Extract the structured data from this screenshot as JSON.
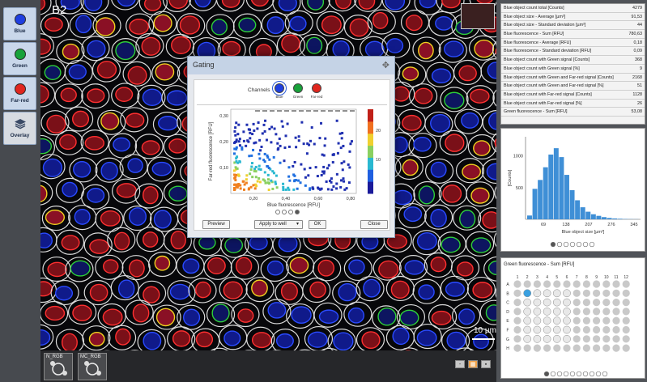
{
  "channels": [
    {
      "label": "Blue",
      "color": "#1f3fe0"
    },
    {
      "label": "Green",
      "color": "#18a23a"
    },
    {
      "label": "Far-red",
      "color": "#e0261e"
    }
  ],
  "overlay_label": "Overlay",
  "viewer": {
    "well": "B2",
    "scale": "10 µm"
  },
  "bottom": {
    "image_buttons": [
      "N_RGB",
      "MC_RGB"
    ],
    "view_buttons": [
      "-",
      "▦",
      "▪"
    ]
  },
  "stats": [
    {
      "label": "Blue object count total [Counts]",
      "value": "4279"
    },
    {
      "label": "Blue object size - Average [µm²]",
      "value": "91,53"
    },
    {
      "label": "Blue object size - Standard deviation [µm²]",
      "value": "44"
    },
    {
      "label": "Blue fluorescence - Sum [RFU]",
      "value": "780,63"
    },
    {
      "label": "Blue fluorescence - Average [RFU]",
      "value": "0,18"
    },
    {
      "label": "Blue fluorescence - Standard deviation [RFU]",
      "value": "0,09"
    },
    {
      "label": "Blue object count with Green signal [Counts]",
      "value": "368"
    },
    {
      "label": "Blue object count  with Green signal [%]",
      "value": "9"
    },
    {
      "label": "Blue object count with Green and Far-red signal [Counts]",
      "value": "2168"
    },
    {
      "label": "Blue object count  with Green and Far-red signal [%]",
      "value": "51"
    },
    {
      "label": "Blue object count with Far-red signal [Counts]",
      "value": "1128"
    },
    {
      "label": "Blue object count  with Far-red signal [%]",
      "value": "26"
    },
    {
      "label": "Green fluorescence - Sum [RFU]",
      "value": "53,08"
    }
  ],
  "histogram": {
    "type": "bar",
    "xlabel": "Blue object size [µm²]",
    "ylabel": "[Counts]",
    "xticks": [
      "69",
      "138",
      "207",
      "276",
      "345"
    ],
    "yticks": [
      "500",
      "1000"
    ],
    "ylim": [
      0,
      1300
    ],
    "bins": [
      60,
      480,
      620,
      820,
      1020,
      1120,
      980,
      700,
      460,
      300,
      190,
      120,
      80,
      55,
      35,
      22,
      14,
      9,
      5,
      3,
      2
    ]
  },
  "plate": {
    "title": "Green fluorescence - Sum [RFU]",
    "columns": [
      "1",
      "2",
      "3",
      "4",
      "5",
      "6",
      "7",
      "8",
      "9",
      "10",
      "11",
      "12"
    ],
    "rows": [
      "A",
      "B",
      "C",
      "D",
      "E",
      "F",
      "G",
      "H"
    ],
    "selected": "B2"
  },
  "gating": {
    "title": "Gating",
    "channels_label": "Channels",
    "channel_names": [
      "Blue",
      "Green",
      "Far-red"
    ],
    "selected_channel": "Blue",
    "xlabel": "Blue fluorescence [RFU]",
    "ylabel": "Far-red fluorescence [RFU]",
    "xticks": [
      "0,20",
      "0,40",
      "0,60",
      "0,80"
    ],
    "yticks": [
      "0,30",
      "0,20",
      "0,10"
    ],
    "colorbar_ticks": [
      "20",
      "10"
    ],
    "buttons": {
      "preview": "Preview",
      "apply": "Apply to well",
      "ok": "OK",
      "close": "Close"
    }
  },
  "chart_data": {
    "type": "bar",
    "title": "",
    "xlabel": "Blue object size [µm²]",
    "ylabel": "[Counts]",
    "x": [
      "69",
      "138",
      "207",
      "276",
      "345"
    ],
    "series": [
      {
        "values": [
          60,
          480,
          620,
          820,
          1020,
          1120,
          980,
          700,
          460,
          300,
          190,
          120,
          80,
          55,
          35,
          22,
          14,
          9,
          5,
          3,
          2
        ]
      }
    ],
    "ylim": [
      0,
      1300
    ]
  }
}
